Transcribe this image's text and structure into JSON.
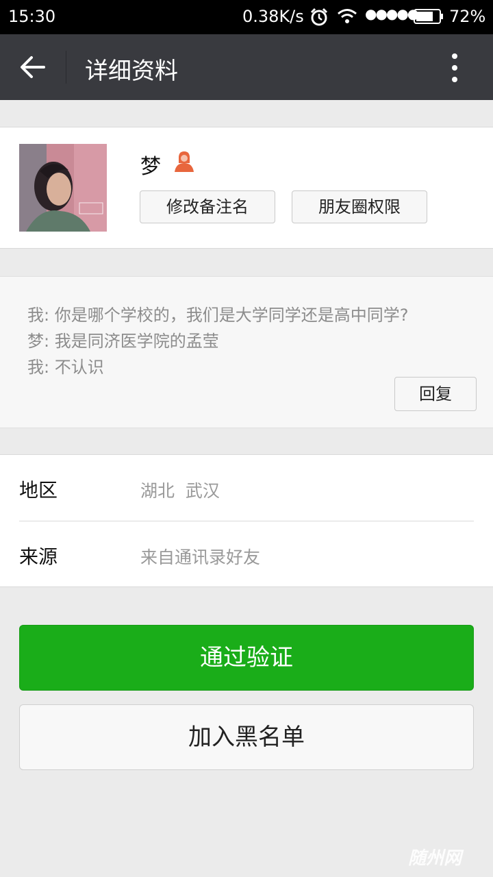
{
  "status_bar": {
    "time": "15:30",
    "network_speed": "0.38K/s",
    "signal_dots": "●●●●●",
    "battery_percent": "72%",
    "battery_level": 0.72,
    "icons": [
      "alarm-icon",
      "wifi-icon",
      "signal-icon",
      "battery-icon"
    ]
  },
  "nav": {
    "title": "详细资料",
    "back_icon": "arrow-left-icon",
    "more_icon": "more-vertical-icon"
  },
  "profile": {
    "nickname": "梦",
    "gender_icon": "female-icon",
    "gender_color": "#e8663d",
    "remark_button": "修改备注名",
    "moments_button": "朋友圈权限"
  },
  "messages": {
    "lines": [
      "我: 你是哪个学校的，我们是大学同学还是高中同学?",
      "梦: 我是同济医学院的孟莹",
      "我: 不认识"
    ],
    "reply_button": "回复"
  },
  "info": {
    "region_label": "地区",
    "region_value": "湖北  武汉",
    "source_label": "来源",
    "source_value": "来自通讯录好友"
  },
  "actions": {
    "verify_button": "通过验证",
    "verify_color": "#1aad19",
    "blacklist_button": "加入黑名单"
  },
  "watermark": "随州网"
}
